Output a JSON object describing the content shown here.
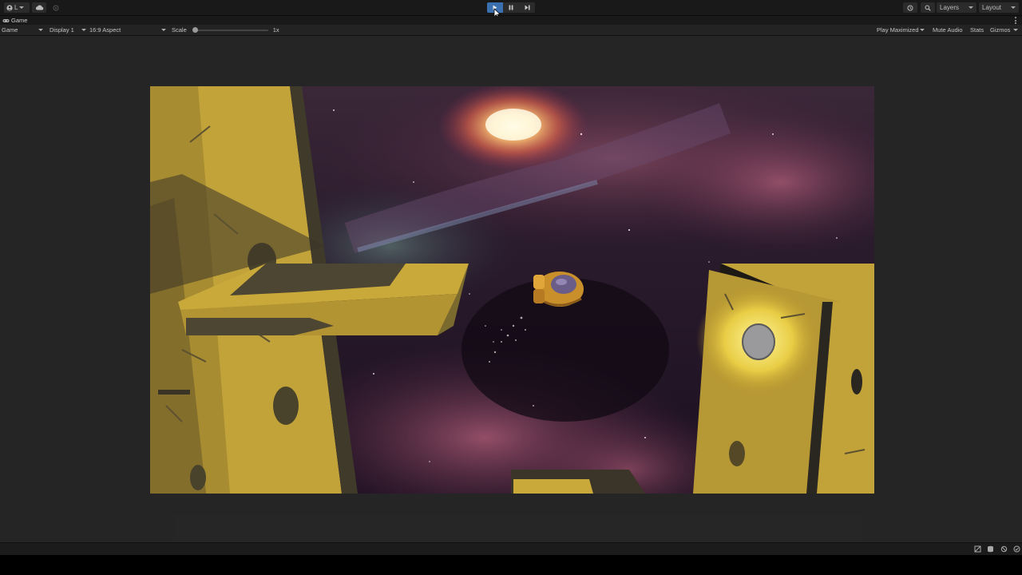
{
  "toolbar": {
    "account_label": "L",
    "layers_label": "Layers",
    "layout_label": "Layout"
  },
  "game_tab": {
    "label": "Game"
  },
  "game_view": {
    "mode": "Game",
    "display": "Display 1",
    "aspect": "16:9 Aspect",
    "scale_label": "Scale",
    "scale_value": "1x",
    "scale_fraction": 0.0,
    "play_maximized": "Play Maximized",
    "mute_audio": "Mute Audio",
    "stats": "Stats",
    "gizmos": "Gizmos"
  },
  "icons": {
    "account": "user-circle-icon",
    "cloud": "cloud-icon",
    "collab": "collab-icon",
    "play": "play-icon",
    "pause": "pause-icon",
    "step": "step-icon",
    "history": "history-icon",
    "search": "search-icon",
    "more": "kebab-menu-icon"
  },
  "colors": {
    "play_active": "#3a6fb0",
    "panel_yellow": "#c9a93a",
    "panel_shadow": "#4a432c"
  }
}
